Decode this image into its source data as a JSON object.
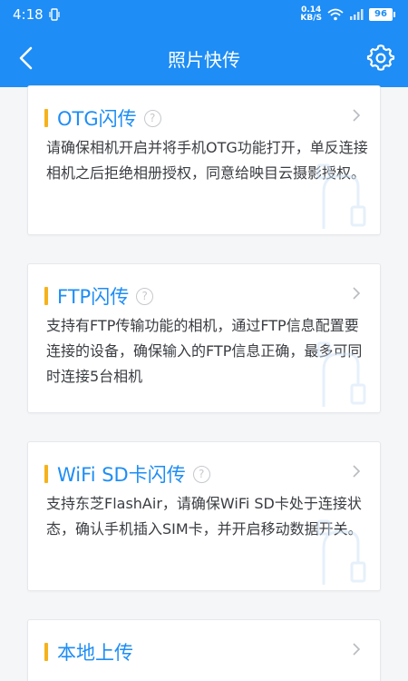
{
  "status_bar": {
    "time": "4:18",
    "net_speed_value": "0.14",
    "net_speed_unit": "KB/S",
    "battery": "96"
  },
  "nav": {
    "title": "照片快传"
  },
  "cards": [
    {
      "title": "OTG闪传",
      "desc": "请确保相机开启并将手机OTG功能打开，单反连接相机之后拒绝相册授权，同意给映目云摄影授权。"
    },
    {
      "title": "FTP闪传",
      "desc": "支持有FTP传输功能的相机，通过FTP信息配置要连接的设备，确保输入的FTP信息正确，最多可同时连接5台相机"
    },
    {
      "title": "WiFi SD卡闪传",
      "desc": "支持东芝FlashAir，请确保WiFi SD卡处于连接状态，确认手机插入SIM卡，并开启移动数据开关。"
    },
    {
      "title": "本地上传"
    }
  ],
  "colors": {
    "brand": "#1e8df5",
    "accent": "#f5b21b"
  },
  "icons": [
    "back-icon",
    "gear-icon",
    "help-icon",
    "chevron-right-icon",
    "wifi-icon",
    "cable-icon"
  ]
}
